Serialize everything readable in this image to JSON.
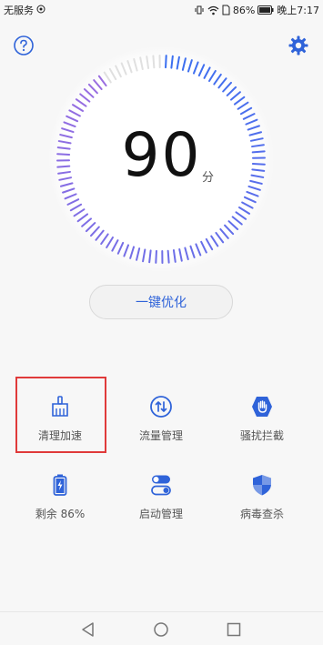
{
  "status_bar": {
    "carrier": "无服务",
    "battery": "86%",
    "time": "晚上7:17"
  },
  "header": {
    "help_icon": "question-circle-icon",
    "settings_icon": "gear-icon"
  },
  "score": {
    "value": "90",
    "unit": "分",
    "progress": 0.9
  },
  "optimize_label": "一键优化",
  "tiles": [
    {
      "label": "清理加速",
      "icon": "broom-icon",
      "highlighted": true
    },
    {
      "label": "流量管理",
      "icon": "data-arrows-icon"
    },
    {
      "label": "骚扰拦截",
      "icon": "hand-shield-icon"
    },
    {
      "label": "剩余 86%",
      "icon": "battery-icon"
    },
    {
      "label": "启动管理",
      "icon": "toggle-icon"
    },
    {
      "label": "病毒查杀",
      "icon": "shield-icon"
    }
  ],
  "colors": {
    "accent": "#2f63d9",
    "gauge_inactive": "#e0e0e0",
    "gauge_start": "#3a6ff0",
    "gauge_end": "#9b6de0",
    "highlight": "#e03a3a"
  }
}
